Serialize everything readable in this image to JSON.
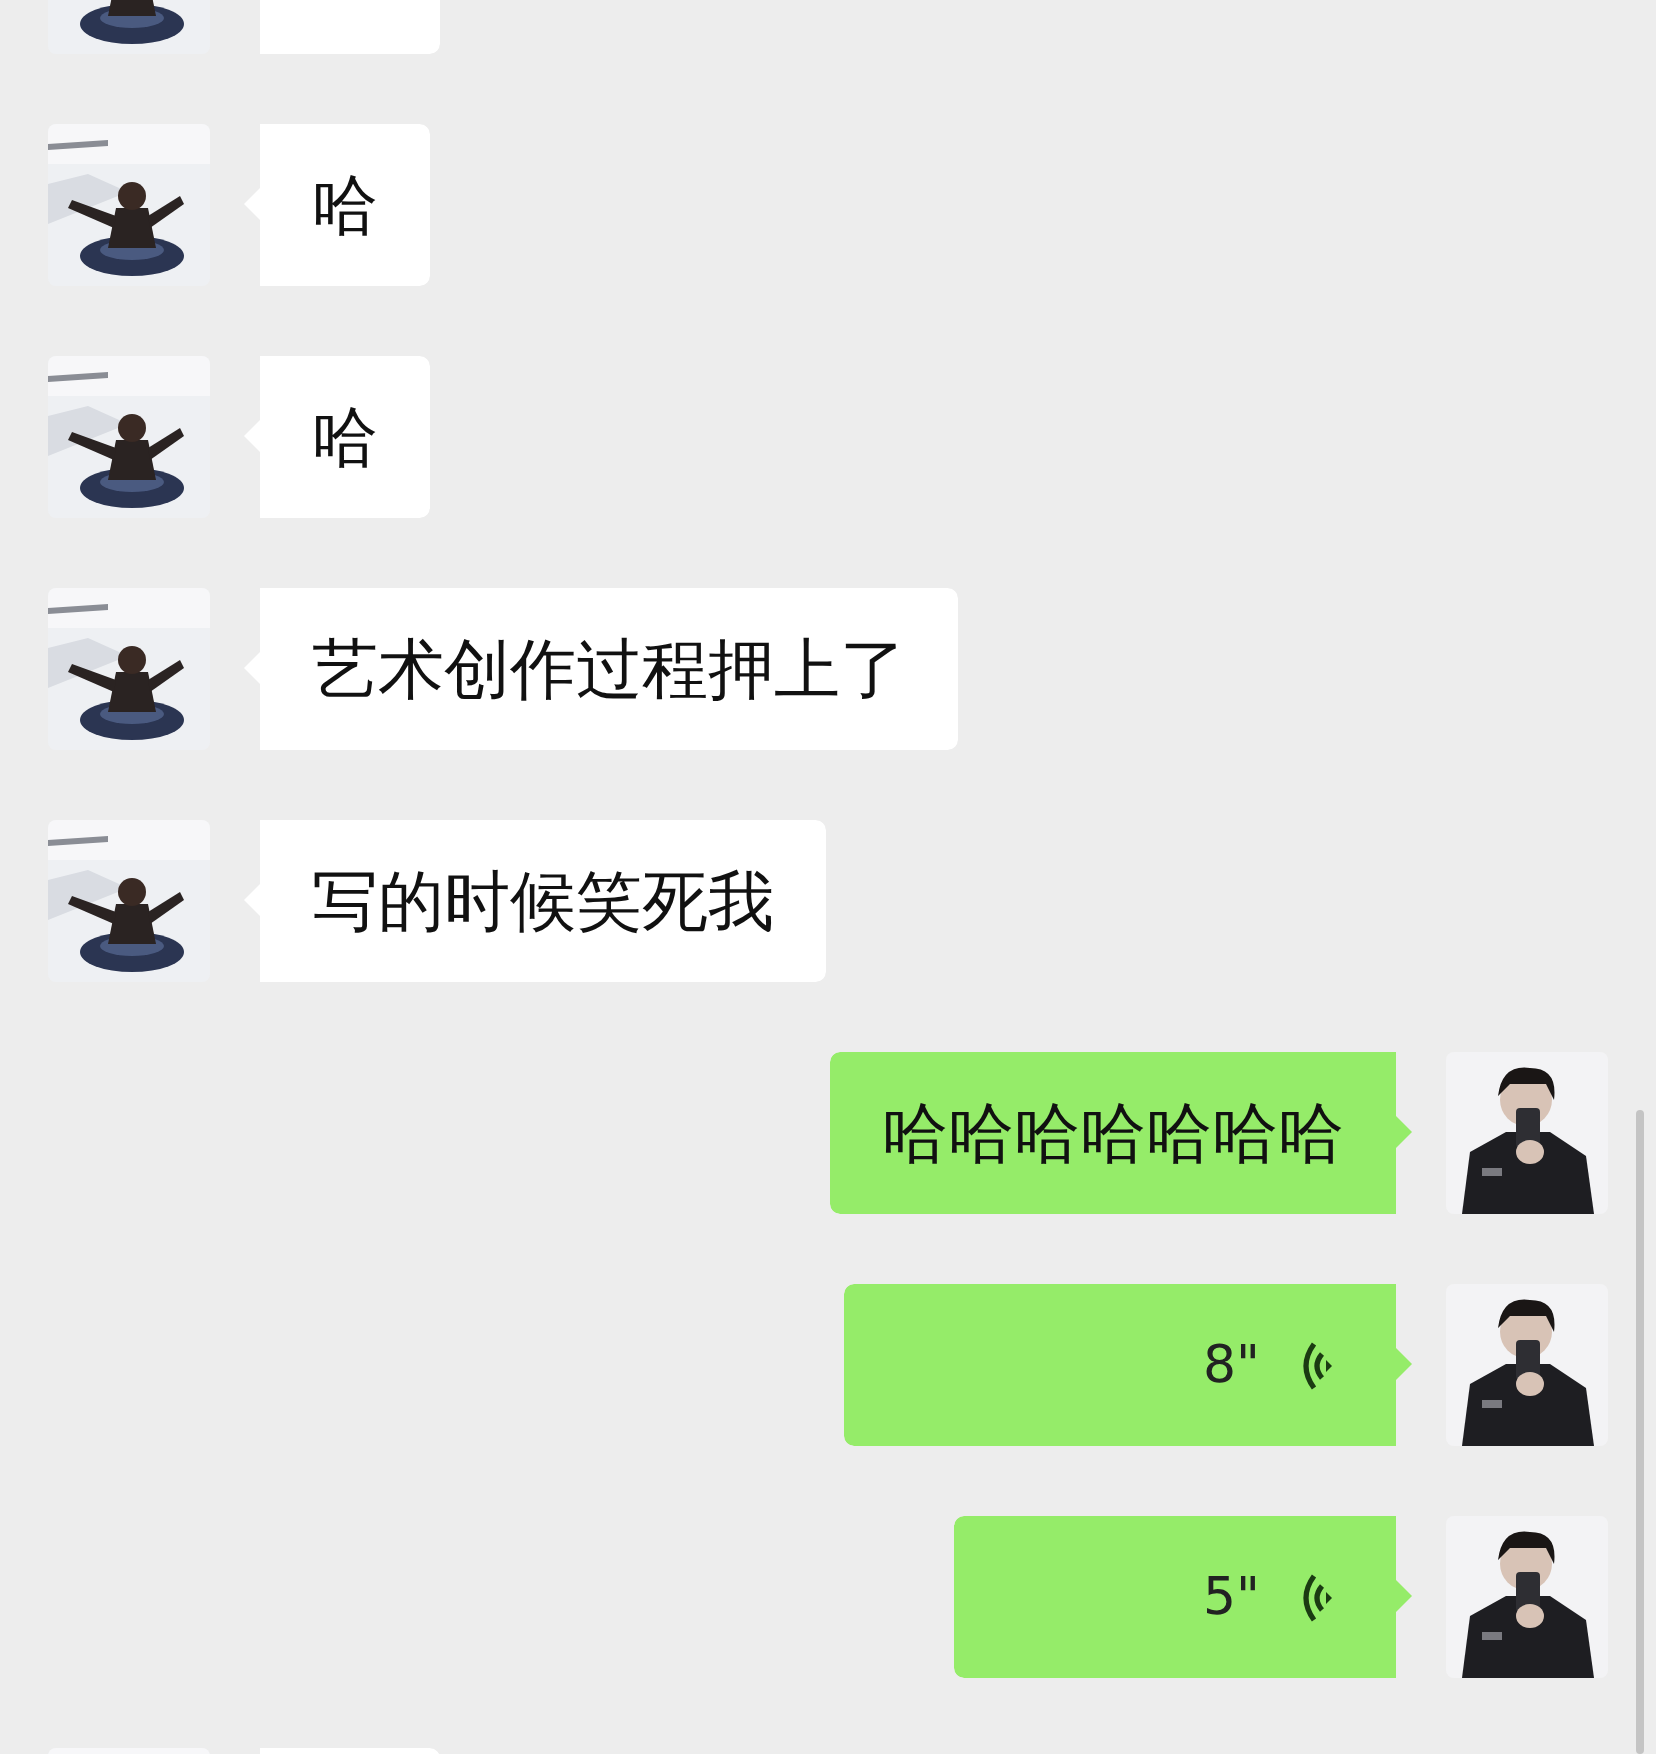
{
  "messages": [
    {
      "sent": false,
      "kind": "partial"
    },
    {
      "sent": false,
      "kind": "text",
      "text": "哈"
    },
    {
      "sent": false,
      "kind": "text",
      "text": "哈"
    },
    {
      "sent": false,
      "kind": "text",
      "text": "艺术创作过程押上了"
    },
    {
      "sent": false,
      "kind": "text",
      "text": "写的时候笑死我"
    },
    {
      "sent": true,
      "kind": "text",
      "text": "哈哈哈哈哈哈哈"
    },
    {
      "sent": true,
      "kind": "voice",
      "duration": "8\""
    },
    {
      "sent": true,
      "kind": "voice",
      "duration": "5\""
    },
    {
      "sent": false,
      "kind": "partial"
    }
  ]
}
